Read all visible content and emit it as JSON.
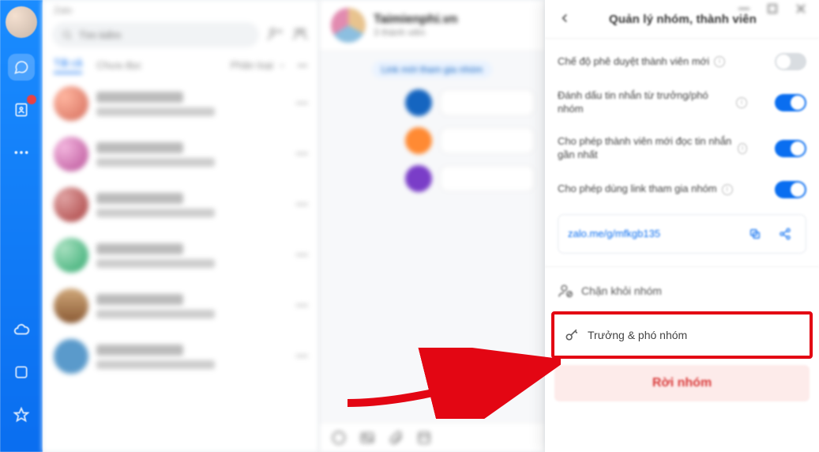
{
  "app_name": "Zalo",
  "window_subtitle": "",
  "search": {
    "placeholder": "Tìm kiếm"
  },
  "tabs": {
    "all": "Tất cả",
    "unread": "Chưa đọc",
    "filter": "Phân loại"
  },
  "group": {
    "name": "Taimienphi.vn",
    "member_count_label": "3 thành viên"
  },
  "chat_pill": "Link mời tham gia nhóm",
  "panel": {
    "title": "Quản lý nhóm, thành viên",
    "opt_approve": "Chế độ phê duyệt thành viên mới",
    "opt_mark_admin": "Đánh dấu tin nhắn từ trưởng/phó nhóm",
    "opt_new_read": "Cho phép thành viên mới đọc tin nhắn gần nhất",
    "opt_link": "Cho phép dùng link tham gia nhóm",
    "invite_link": "zalo.me/g/mfkgb135",
    "block_label": "Chặn khỏi nhóm",
    "admin_label": "Trưởng & phó nhóm",
    "leave_label": "Rời nhóm"
  },
  "toggles": {
    "approve": false,
    "mark_admin": true,
    "new_read": true,
    "link": true
  }
}
